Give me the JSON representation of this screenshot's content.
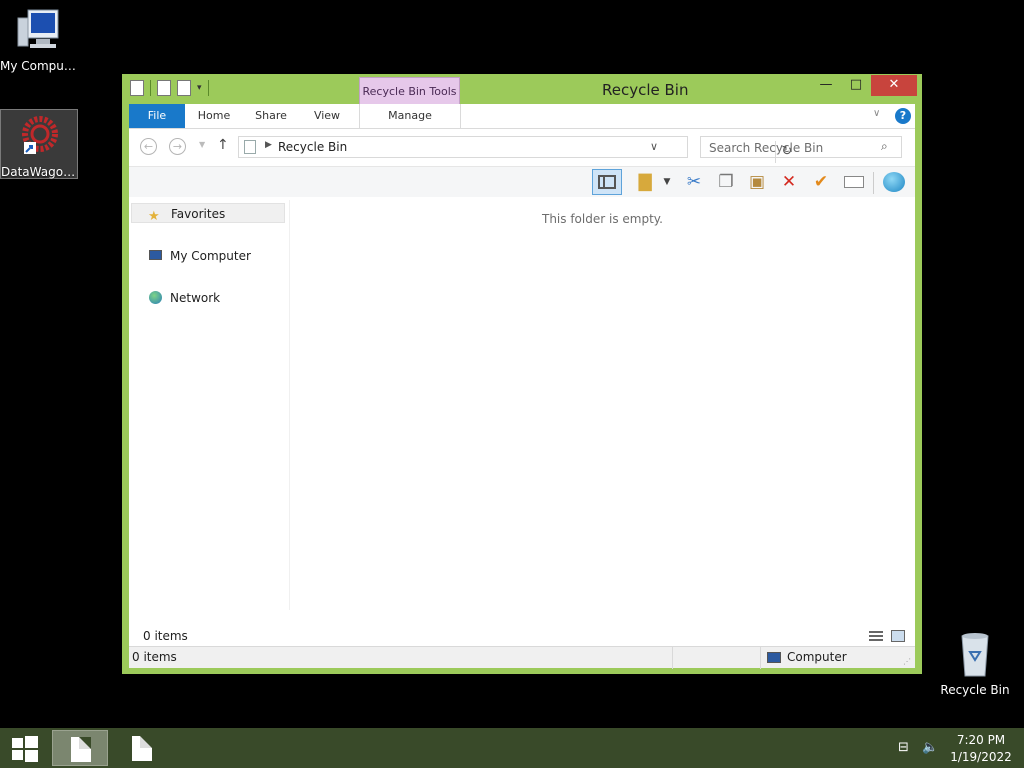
{
  "desktop": {
    "icons": [
      {
        "label": "My Computer"
      },
      {
        "label": "DataWagon..."
      },
      {
        "label": "Recycle Bin"
      }
    ]
  },
  "window": {
    "title": "Recycle Bin",
    "contextual_tab": "Recycle Bin Tools",
    "controls": {
      "minimize": "—",
      "maximize": "□",
      "close": "✕"
    },
    "ribbon_tabs": [
      "File",
      "Home",
      "Share",
      "View",
      "Manage"
    ],
    "address": {
      "path": "Recycle Bin"
    },
    "search": {
      "placeholder": "Search Recycle Bin"
    },
    "nav_pane": {
      "items": [
        {
          "label": "Favorites",
          "icon": "star-icon"
        },
        {
          "label": "My Computer",
          "icon": "computer-icon"
        },
        {
          "label": "Network",
          "icon": "network-icon"
        }
      ]
    },
    "content": {
      "empty_message": "This folder is empty."
    },
    "item_count": "0 items",
    "statusbar": {
      "count": "0 items",
      "location": "Computer"
    }
  },
  "taskbar": {
    "clock": {
      "time": "7:20 PM",
      "date": "1/19/2022"
    }
  },
  "colors": {
    "window_frame": "#9cca5a",
    "file_tab": "#1979ca",
    "contextual_tab": "#e6c8ea",
    "close_button": "#c8443d",
    "taskbar": "#394a29"
  }
}
